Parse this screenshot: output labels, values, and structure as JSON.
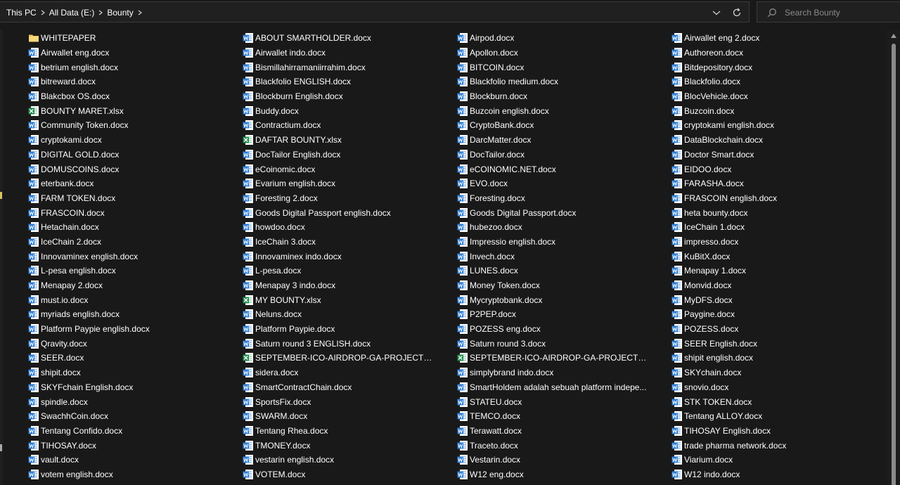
{
  "breadcrumbs": [
    "This PC",
    "All Data (E:)",
    "Bounty"
  ],
  "search": {
    "placeholder": "Search Bounty"
  },
  "colors": {
    "folder": "#f3c75a",
    "word": "#2b7cd3",
    "excel": "#1e8a4c"
  },
  "files": [
    {
      "name": "WHITEPAPER",
      "type": "folder"
    },
    {
      "name": "ABOUT SMARTHOLDER.docx",
      "type": "word"
    },
    {
      "name": "Airpod.docx",
      "type": "word"
    },
    {
      "name": "Airwallet eng 2.docx",
      "type": "word"
    },
    {
      "name": "Airwallet eng.docx",
      "type": "word"
    },
    {
      "name": "Airwallet indo.docx",
      "type": "word"
    },
    {
      "name": "Apollon.docx",
      "type": "word"
    },
    {
      "name": "Authoreon.docx",
      "type": "word"
    },
    {
      "name": "betrium english.docx",
      "type": "word"
    },
    {
      "name": "Bismillahirramaniirrahim.docx",
      "type": "word"
    },
    {
      "name": "BITCOIN.docx",
      "type": "word"
    },
    {
      "name": "Bitdepository.docx",
      "type": "word"
    },
    {
      "name": "bitreward.docx",
      "type": "word"
    },
    {
      "name": "Blackfolio ENGLISH.docx",
      "type": "word"
    },
    {
      "name": "Blackfolio medium.docx",
      "type": "word"
    },
    {
      "name": "Blackfolio.docx",
      "type": "word"
    },
    {
      "name": "Blakcbox OS.docx",
      "type": "word"
    },
    {
      "name": "Blockburn English.docx",
      "type": "word"
    },
    {
      "name": "Blockburn.docx",
      "type": "word"
    },
    {
      "name": "BlocVehicle.docx",
      "type": "word"
    },
    {
      "name": "BOUNTY MARET.xlsx",
      "type": "excel"
    },
    {
      "name": "Buddy.docx",
      "type": "word"
    },
    {
      "name": "Buzcoin english.docx",
      "type": "word"
    },
    {
      "name": "Buzcoin.docx",
      "type": "word"
    },
    {
      "name": "Community Token.docx",
      "type": "word"
    },
    {
      "name": "Contractium.docx",
      "type": "word"
    },
    {
      "name": "CryptoBank.docx",
      "type": "word"
    },
    {
      "name": "cryptokami english.docx",
      "type": "word"
    },
    {
      "name": "cryptokami.docx",
      "type": "word"
    },
    {
      "name": "DAFTAR BOUNTY.xlsx",
      "type": "excel"
    },
    {
      "name": "DarcMatter.docx",
      "type": "word"
    },
    {
      "name": "DataBlockchain.docx",
      "type": "word"
    },
    {
      "name": "DIGITAL GOLD.docx",
      "type": "word"
    },
    {
      "name": "DocTailor English.docx",
      "type": "word"
    },
    {
      "name": "DocTailor.docx",
      "type": "word"
    },
    {
      "name": "Doctor Smart.docx",
      "type": "word"
    },
    {
      "name": "DOMUSCOINS.docx",
      "type": "word"
    },
    {
      "name": "eCoinomic.docx",
      "type": "word"
    },
    {
      "name": "eCOINOMIC.NET.docx",
      "type": "word"
    },
    {
      "name": "EIDOO.docx",
      "type": "word"
    },
    {
      "name": "eterbank.docx",
      "type": "word"
    },
    {
      "name": "Evarium english.docx",
      "type": "word"
    },
    {
      "name": "EVO.docx",
      "type": "word"
    },
    {
      "name": "FARASHA.docx",
      "type": "word"
    },
    {
      "name": "FARM TOKEN.docx",
      "type": "word"
    },
    {
      "name": "Foresting 2.docx",
      "type": "word"
    },
    {
      "name": "Foresting.docx",
      "type": "word"
    },
    {
      "name": "FRASCOIN english.docx",
      "type": "word"
    },
    {
      "name": "FRASCOIN.docx",
      "type": "word"
    },
    {
      "name": "Goods Digital Passport english.docx",
      "type": "word"
    },
    {
      "name": "Goods Digital Passport.docx",
      "type": "word"
    },
    {
      "name": "heta bounty.docx",
      "type": "word"
    },
    {
      "name": "Hetachain.docx",
      "type": "word"
    },
    {
      "name": "howdoo.docx",
      "type": "word"
    },
    {
      "name": "hubezoo.docx",
      "type": "word"
    },
    {
      "name": "IceChain 1.docx",
      "type": "word"
    },
    {
      "name": "IceChain 2.docx",
      "type": "word"
    },
    {
      "name": "IceChain 3.docx",
      "type": "word"
    },
    {
      "name": "Impressio english.docx",
      "type": "word"
    },
    {
      "name": "impresso.docx",
      "type": "word"
    },
    {
      "name": "Innovaminex english.docx",
      "type": "word"
    },
    {
      "name": "Innovaminex indo.docx",
      "type": "word"
    },
    {
      "name": "Invech.docx",
      "type": "word"
    },
    {
      "name": "KuBitX.docx",
      "type": "word"
    },
    {
      "name": "L-pesa english.docx",
      "type": "word"
    },
    {
      "name": "L-pesa.docx",
      "type": "word"
    },
    {
      "name": "LUNES.docx",
      "type": "word"
    },
    {
      "name": "Menapay 1.docx",
      "type": "word"
    },
    {
      "name": "Menapay 2.docx",
      "type": "word"
    },
    {
      "name": "Menapay 3 indo.docx",
      "type": "word"
    },
    {
      "name": "Money Token.docx",
      "type": "word"
    },
    {
      "name": "Monvid.docx",
      "type": "word"
    },
    {
      "name": "must.io.docx",
      "type": "word"
    },
    {
      "name": "MY BOUNTY.xlsx",
      "type": "excel"
    },
    {
      "name": "Mycryptobank.docx",
      "type": "word"
    },
    {
      "name": "MyDFS.docx",
      "type": "word"
    },
    {
      "name": "myriads english.docx",
      "type": "word"
    },
    {
      "name": "Neluns.docx",
      "type": "word"
    },
    {
      "name": "P2PEP.docx",
      "type": "word"
    },
    {
      "name": "Paygine.docx",
      "type": "word"
    },
    {
      "name": "Platform Paypie english.docx",
      "type": "word"
    },
    {
      "name": "Platform Paypie.docx",
      "type": "word"
    },
    {
      "name": "POZESS eng.docx",
      "type": "word"
    },
    {
      "name": "POZESS.docx",
      "type": "word"
    },
    {
      "name": "Qravity.docx",
      "type": "word"
    },
    {
      "name": "Saturn round 3 ENGLISH.docx",
      "type": "word"
    },
    {
      "name": "Saturn round 3.docx",
      "type": "word"
    },
    {
      "name": "SEER English.docx",
      "type": "word"
    },
    {
      "name": "SEER.docx",
      "type": "word"
    },
    {
      "name": "SEPTEMBER-ICO-AIRDROP-GA-PROJECTS-201...",
      "type": "excel"
    },
    {
      "name": "SEPTEMBER-ICO-AIRDROP-GA-PROJECTS-201...",
      "type": "excel"
    },
    {
      "name": "shipit english.docx",
      "type": "word"
    },
    {
      "name": "shipit.docx",
      "type": "word"
    },
    {
      "name": "sidera.docx",
      "type": "word"
    },
    {
      "name": "simplybrand indo.docx",
      "type": "word"
    },
    {
      "name": "SKYchain.docx",
      "type": "word"
    },
    {
      "name": "SKYFchain English.docx",
      "type": "word"
    },
    {
      "name": "SmartContractChain.docx",
      "type": "word"
    },
    {
      "name": "SmartHoldem adalah sebuah platform indepe...",
      "type": "word"
    },
    {
      "name": "snovio.docx",
      "type": "word"
    },
    {
      "name": "spindle.docx",
      "type": "word"
    },
    {
      "name": "SportsFix.docx",
      "type": "word"
    },
    {
      "name": "STATEU.docx",
      "type": "word"
    },
    {
      "name": "STK TOKEN.docx",
      "type": "word"
    },
    {
      "name": "SwachhCoin.docx",
      "type": "word"
    },
    {
      "name": "SWARM.docx",
      "type": "word"
    },
    {
      "name": "TEMCO.docx",
      "type": "word"
    },
    {
      "name": "Tentang ALLOY.docx",
      "type": "word"
    },
    {
      "name": "Tentang Confido.docx",
      "type": "word"
    },
    {
      "name": "Tentang Rhea.docx",
      "type": "word"
    },
    {
      "name": "Terawatt.docx",
      "type": "word"
    },
    {
      "name": "TIHOSAY English.docx",
      "type": "word"
    },
    {
      "name": "TIHOSAY.docx",
      "type": "word"
    },
    {
      "name": "TMONEY.docx",
      "type": "word"
    },
    {
      "name": "Traceto.docx",
      "type": "word"
    },
    {
      "name": "trade pharma network.docx",
      "type": "word"
    },
    {
      "name": "vault.docx",
      "type": "word"
    },
    {
      "name": "vestarin english.docx",
      "type": "word"
    },
    {
      "name": "Vestarin.docx",
      "type": "word"
    },
    {
      "name": "Viarium.docx",
      "type": "word"
    },
    {
      "name": "votem english.docx",
      "type": "word"
    },
    {
      "name": "VOTEM.docx",
      "type": "word"
    },
    {
      "name": "W12 eng.docx",
      "type": "word"
    },
    {
      "name": "W12 indo.docx",
      "type": "word"
    }
  ]
}
